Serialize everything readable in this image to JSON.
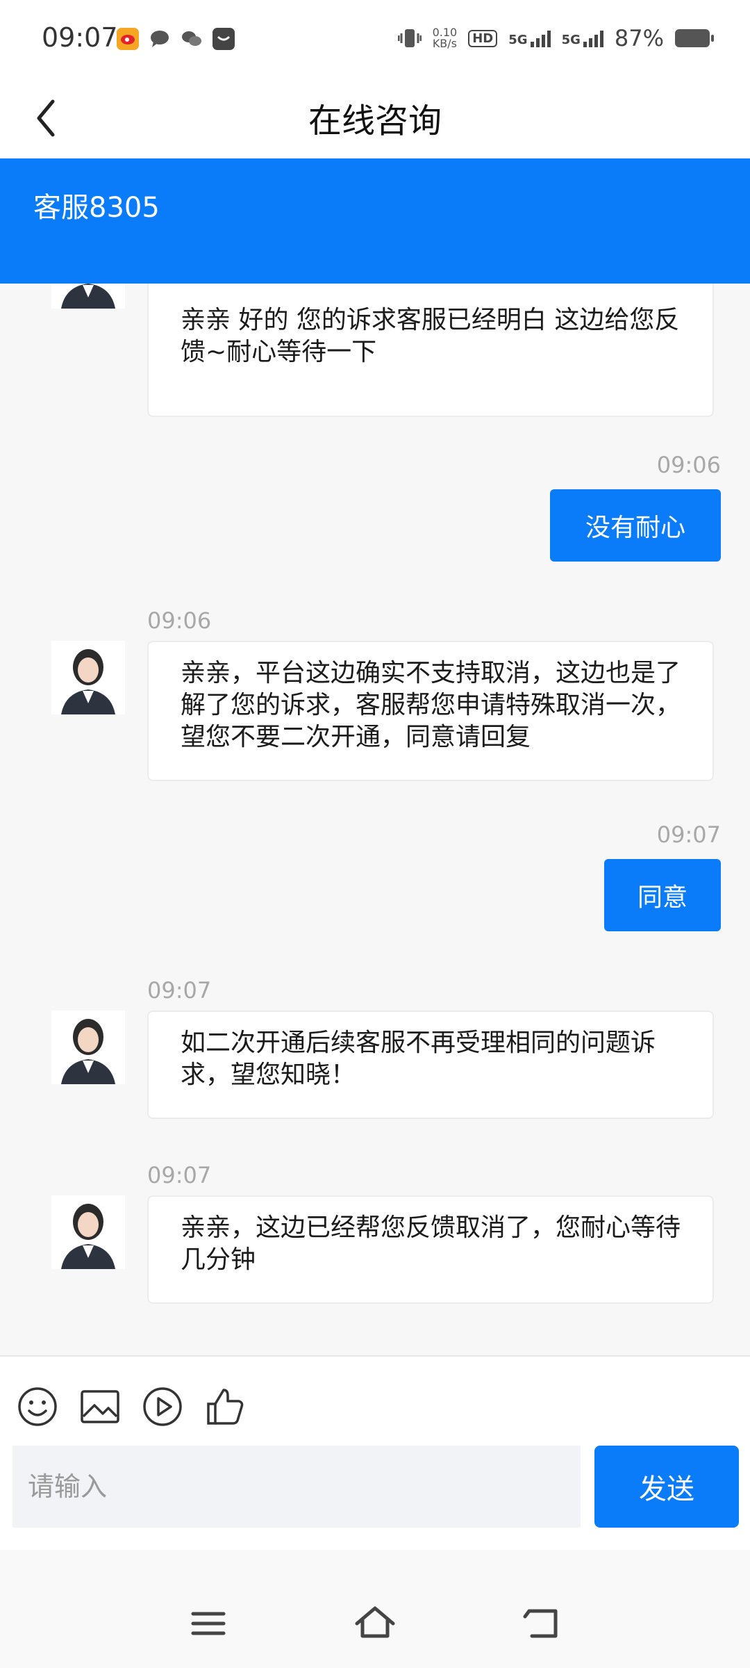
{
  "status_bar": {
    "time": "09:07",
    "net_speed": "0.10",
    "net_unit": "KB/s",
    "hd_label": "HD",
    "sim1": "5G",
    "sim2": "5G",
    "battery": "87%"
  },
  "header": {
    "title": "在线咨询",
    "agent_name": "客服8305"
  },
  "messages": [
    {
      "side": "left",
      "text": "亲亲 好的 您的诉求客服已经明白 这边给您反馈~耐心等待一下"
    },
    {
      "side": "right",
      "time": "09:06",
      "text": "没有耐心"
    },
    {
      "side": "left",
      "time": "09:06",
      "text": "亲亲，平台这边确实不支持取消，这边也是了解了您的诉求，客服帮您申请特殊取消一次，望您不要二次开通，同意请回复"
    },
    {
      "side": "right",
      "time": "09:07",
      "text": "同意"
    },
    {
      "side": "left",
      "time": "09:07",
      "text": "如二次开通后续客服不再受理相同的问题诉求，望您知晓！"
    },
    {
      "side": "left",
      "time": "09:07",
      "text": "亲亲，这边已经帮您反馈取消了，您耐心等待几分钟"
    }
  ],
  "composer": {
    "placeholder": "请输入",
    "send_label": "发送",
    "tools": [
      "emoji-icon",
      "image-icon",
      "video-icon",
      "thumbs-up-icon"
    ]
  },
  "nav": [
    "menu-icon",
    "home-icon",
    "back-icon"
  ],
  "colors": {
    "accent": "#0a7cfa",
    "background": "#f7f7f8",
    "time_text": "#a8a8a8"
  }
}
